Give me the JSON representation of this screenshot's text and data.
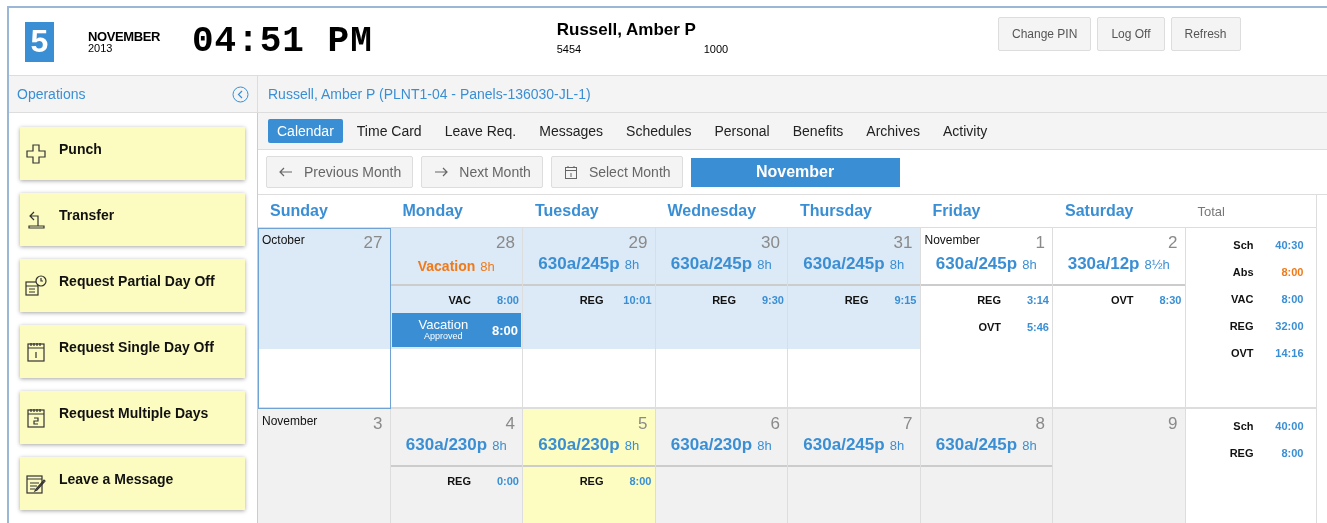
{
  "header": {
    "day": "5",
    "month": "NOVEMBER",
    "year": "2013",
    "clock": "04:51 PM",
    "employee": {
      "name": "Russell, Amber P",
      "id": "5454",
      "code": "1000"
    },
    "buttons": [
      "Change PIN",
      "Log Off",
      "Refresh"
    ]
  },
  "sidebar": {
    "title": "Operations",
    "items": [
      {
        "label": "Punch",
        "kind": "punch"
      },
      {
        "label": "Transfer",
        "kind": "transfer"
      },
      {
        "label": "Request Partial Day Off",
        "kind": "partial"
      },
      {
        "label": "Request Single Day Off",
        "kind": "single"
      },
      {
        "label": "Request Multiple Days",
        "kind": "multiple"
      },
      {
        "label": "Leave a Message",
        "kind": "message"
      }
    ]
  },
  "title": "Russell, Amber P (PLNT1-04 - Panels-136030-JL-1)",
  "tabs": [
    {
      "label": "Calendar",
      "selected": true
    },
    {
      "label": "Time Card",
      "selected": false
    },
    {
      "label": "Leave Req.",
      "selected": false
    },
    {
      "label": "Messages",
      "selected": false
    },
    {
      "label": "Schedules",
      "selected": false
    },
    {
      "label": "Personal",
      "selected": false
    },
    {
      "label": "Benefits",
      "selected": false
    },
    {
      "label": "Archives",
      "selected": false
    },
    {
      "label": "Activity",
      "selected": false
    }
  ],
  "toolbar": {
    "previous": "Previous Month",
    "next": "Next Month",
    "select": "Select Month",
    "month": "November"
  },
  "calendar": {
    "weekdays": [
      "Sunday",
      "Monday",
      "Tuesday",
      "Wednesday",
      "Thursday",
      "Friday",
      "Saturday"
    ],
    "total_label": "Total",
    "weeks": [
      {
        "days": [
          {
            "day": "27",
            "month_label": "October",
            "past": true,
            "future": false,
            "today": false,
            "selected": true
          },
          {
            "day": "28",
            "past": true,
            "future": false,
            "today": false,
            "selected": false,
            "schedule": "Vacation",
            "hours": "8h",
            "absence": true,
            "entries": [
              {
                "code": "VAC",
                "time": "8:00"
              }
            ],
            "request": {
              "title": "Vacation",
              "status": "Approved",
              "time": "8:00"
            }
          },
          {
            "day": "29",
            "past": true,
            "future": false,
            "today": false,
            "selected": false,
            "schedule": "630a/245p",
            "hours": "8h",
            "absence": false,
            "entries": [
              {
                "code": "REG",
                "time": "10:01"
              }
            ]
          },
          {
            "day": "30",
            "past": true,
            "future": false,
            "today": false,
            "selected": false,
            "schedule": "630a/245p",
            "hours": "8h",
            "absence": false,
            "entries": [
              {
                "code": "REG",
                "time": "9:30"
              }
            ]
          },
          {
            "day": "31",
            "past": true,
            "future": false,
            "today": false,
            "selected": false,
            "schedule": "630a/245p",
            "hours": "8h",
            "absence": false,
            "entries": [
              {
                "code": "REG",
                "time": "9:15"
              }
            ]
          },
          {
            "day": "1",
            "month_label": "November",
            "past": false,
            "future": false,
            "today": false,
            "selected": false,
            "schedule": "630a/245p",
            "hours": "8h",
            "absence": false,
            "entries": [
              {
                "code": "REG",
                "time": "3:14"
              },
              {
                "code": "OVT",
                "time": "5:46"
              }
            ]
          },
          {
            "day": "2",
            "past": false,
            "future": false,
            "today": false,
            "selected": false,
            "schedule": "330a/12p",
            "hours": "8½h",
            "absence": false,
            "entries": [
              {
                "code": "OVT",
                "time": "8:30"
              }
            ]
          }
        ],
        "totals": [
          {
            "code": "Sch",
            "value": "40:30",
            "absence": false
          },
          {
            "code": "Abs",
            "value": "8:00",
            "absence": true
          },
          {
            "code": "VAC",
            "value": "8:00",
            "absence": false
          },
          {
            "code": "REG",
            "value": "32:00",
            "absence": false
          },
          {
            "code": "OVT",
            "value": "14:16",
            "absence": false
          }
        ]
      },
      {
        "days": [
          {
            "day": "3",
            "month_label": "November",
            "past": false,
            "future": true,
            "today": false,
            "selected": false
          },
          {
            "day": "4",
            "past": false,
            "future": true,
            "today": false,
            "selected": false,
            "schedule": "630a/230p",
            "hours": "8h",
            "absence": false,
            "entries": [
              {
                "code": "REG",
                "time": "0:00"
              }
            ]
          },
          {
            "day": "5",
            "past": false,
            "future": false,
            "today": true,
            "selected": false,
            "schedule": "630a/230p",
            "hours": "8h",
            "absence": false,
            "entries": [
              {
                "code": "REG",
                "time": "8:00"
              }
            ]
          },
          {
            "day": "6",
            "past": false,
            "future": true,
            "today": false,
            "selected": false,
            "schedule": "630a/230p",
            "hours": "8h",
            "absence": false
          },
          {
            "day": "7",
            "past": false,
            "future": true,
            "today": false,
            "selected": false,
            "schedule": "630a/245p",
            "hours": "8h",
            "absence": false
          },
          {
            "day": "8",
            "past": false,
            "future": true,
            "today": false,
            "selected": false,
            "schedule": "630a/245p",
            "hours": "8h",
            "absence": false
          },
          {
            "day": "9",
            "past": false,
            "future": true,
            "today": false,
            "selected": false
          }
        ],
        "totals": [
          {
            "code": "Sch",
            "value": "40:00",
            "absence": false
          },
          {
            "code": "REG",
            "value": "8:00",
            "absence": false
          }
        ]
      }
    ]
  }
}
